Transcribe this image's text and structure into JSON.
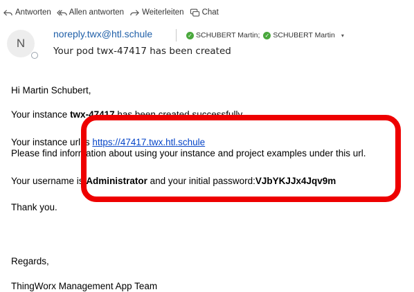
{
  "toolbar": {
    "reply": "Antworten",
    "reply_all": "Allen antworten",
    "forward": "Weiterleiten",
    "chat": "Chat"
  },
  "header": {
    "avatar_initial": "N",
    "sender": "noreply.twx@htl.schule",
    "recipient_1": "SCHUBERT Martin;",
    "recipient_2": "SCHUBERT Martin",
    "subject": "Your pod twx-47417 has been created"
  },
  "body": {
    "greeting": "Hi Martin Schubert,",
    "l2_prefix": "Your instance ",
    "l2_bold": "twx-47417",
    "l2_suffix": " has been created successfully.",
    "l3_prefix": "Your instance url is ",
    "l3_link": "https://47417.twx.htl.schule",
    "l4": "Please find information about using your instance and project examples under this url.",
    "l5_prefix": "Your username is ",
    "l5_user": "Administrator",
    "l5_mid": " and your initial password:",
    "l5_pass": "VJbYKJJx4Jqv9m",
    "thanks": "Thank you.",
    "regards": "Regards,",
    "team": "ThingWorx Management App Team"
  },
  "colors": {
    "accent_link": "#1f5fa8",
    "highlight": "#ee0000",
    "presence_ok": "#4aa83d"
  }
}
